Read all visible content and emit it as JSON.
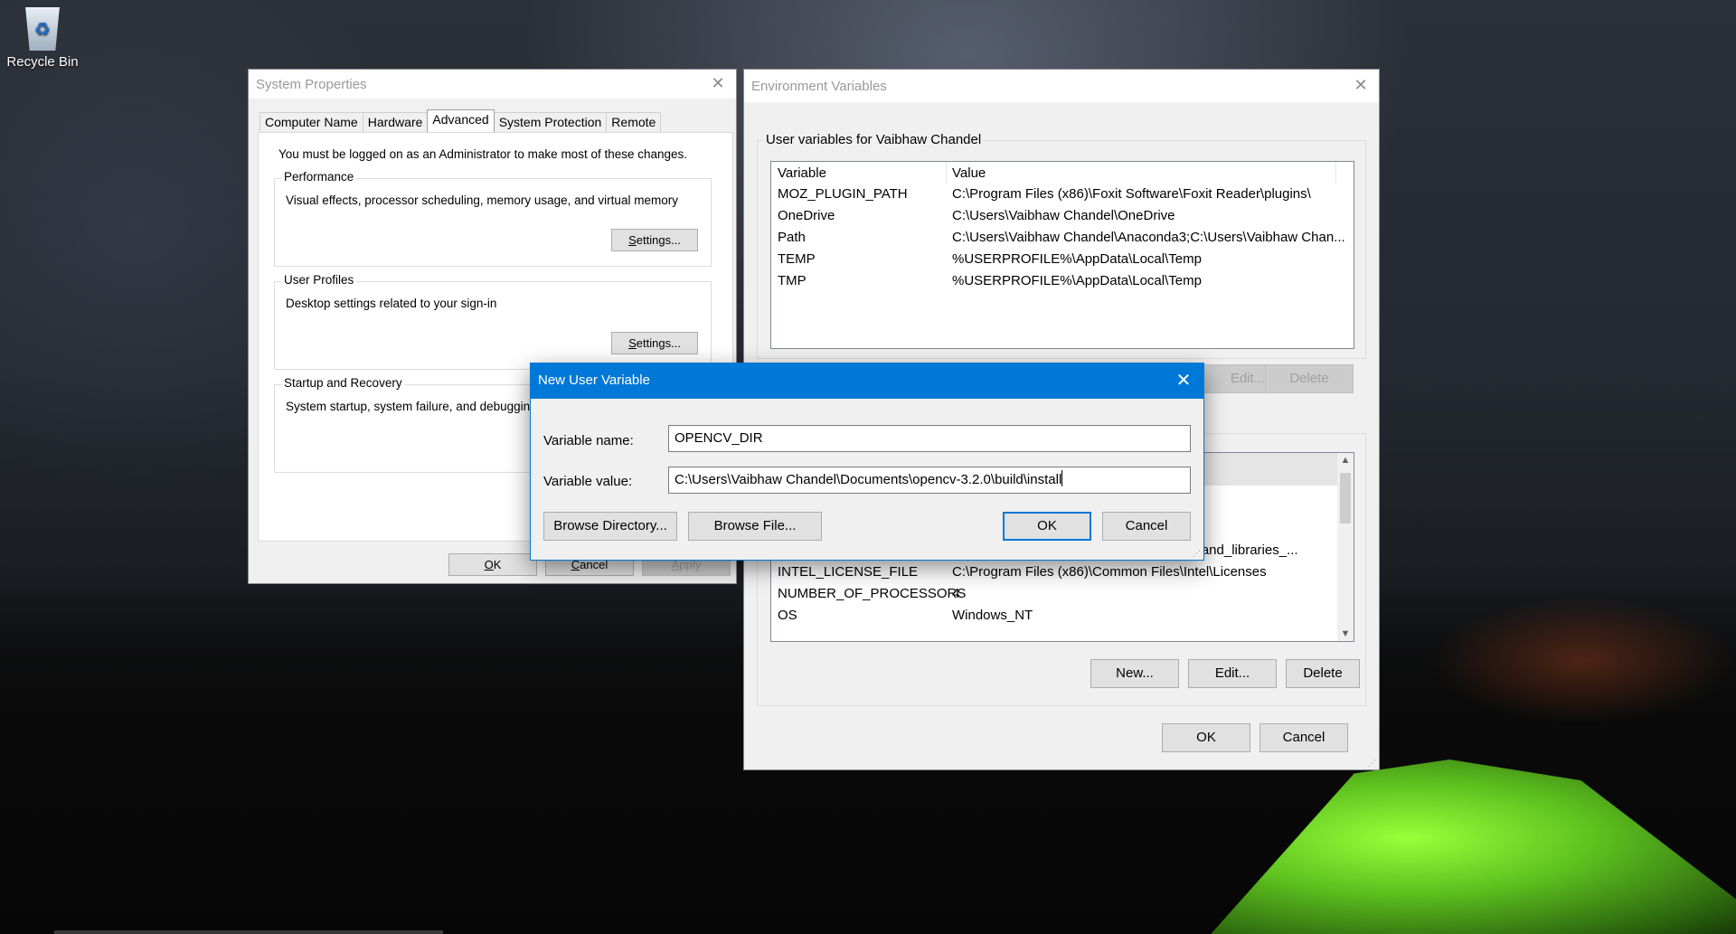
{
  "desktop": {
    "recycle_bin_label": "Recycle Bin"
  },
  "system_properties": {
    "title": "System Properties",
    "tabs": [
      "Computer Name",
      "Hardware",
      "Advanced",
      "System Protection",
      "Remote"
    ],
    "active_tab": "Advanced",
    "admin_message": "You must be logged on as an Administrator to make most of these changes.",
    "performance": {
      "title": "Performance",
      "description": "Visual effects, processor scheduling, memory usage, and virtual memory",
      "button": "Settings..."
    },
    "user_profiles": {
      "title": "User Profiles",
      "description": "Desktop settings related to your sign-in",
      "button": "Settings..."
    },
    "startup_recovery": {
      "title": "Startup and Recovery",
      "description": "System startup, system failure, and debugging"
    },
    "buttons": {
      "ok": "OK",
      "cancel": "Cancel",
      "apply": "Apply"
    }
  },
  "environment_variables": {
    "title": "Environment Variables",
    "user_section_title": "User variables for Vaibhaw Chandel",
    "columns": {
      "variable": "Variable",
      "value": "Value"
    },
    "user_variables": [
      {
        "name": "MOZ_PLUGIN_PATH",
        "value": "C:\\Program Files (x86)\\Foxit Software\\Foxit Reader\\plugins\\"
      },
      {
        "name": "OneDrive",
        "value": "C:\\Users\\Vaibhaw Chandel\\OneDrive"
      },
      {
        "name": "Path",
        "value": "C:\\Users\\Vaibhaw Chandel\\Anaconda3;C:\\Users\\Vaibhaw Chan..."
      },
      {
        "name": "TEMP",
        "value": "%USERPROFILE%\\AppData\\Local\\Temp"
      },
      {
        "name": "TMP",
        "value": "%USERPROFILE%\\AppData\\Local\\Temp"
      }
    ],
    "user_buttons": {
      "edit": "Edit...",
      "delete": "Delete"
    },
    "system_variables": [
      {
        "name": "",
        "value": "ilers_and_libraries_..."
      },
      {
        "name": "INTEL_LICENSE_FILE",
        "value": "C:\\Program Files (x86)\\Common Files\\Intel\\Licenses"
      },
      {
        "name": "NUMBER_OF_PROCESSORS",
        "value": "4"
      },
      {
        "name": "OS",
        "value": "Windows_NT"
      }
    ],
    "system_buttons": {
      "new": "New...",
      "edit": "Edit...",
      "delete": "Delete"
    },
    "buttons": {
      "ok": "OK",
      "cancel": "Cancel"
    }
  },
  "new_user_variable": {
    "title": "New User Variable",
    "name_label": "Variable name:",
    "name_value": "OPENCV_DIR",
    "value_label": "Variable value:",
    "value_value": "C:\\Users\\Vaibhaw Chandel\\Documents\\opencv-3.2.0\\build\\install",
    "buttons": {
      "browse_directory": "Browse Directory...",
      "browse_file": "Browse File...",
      "ok": "OK",
      "cancel": "Cancel"
    }
  },
  "colors": {
    "accent": "#0078d7",
    "window_bg": "#f0f0f0"
  }
}
